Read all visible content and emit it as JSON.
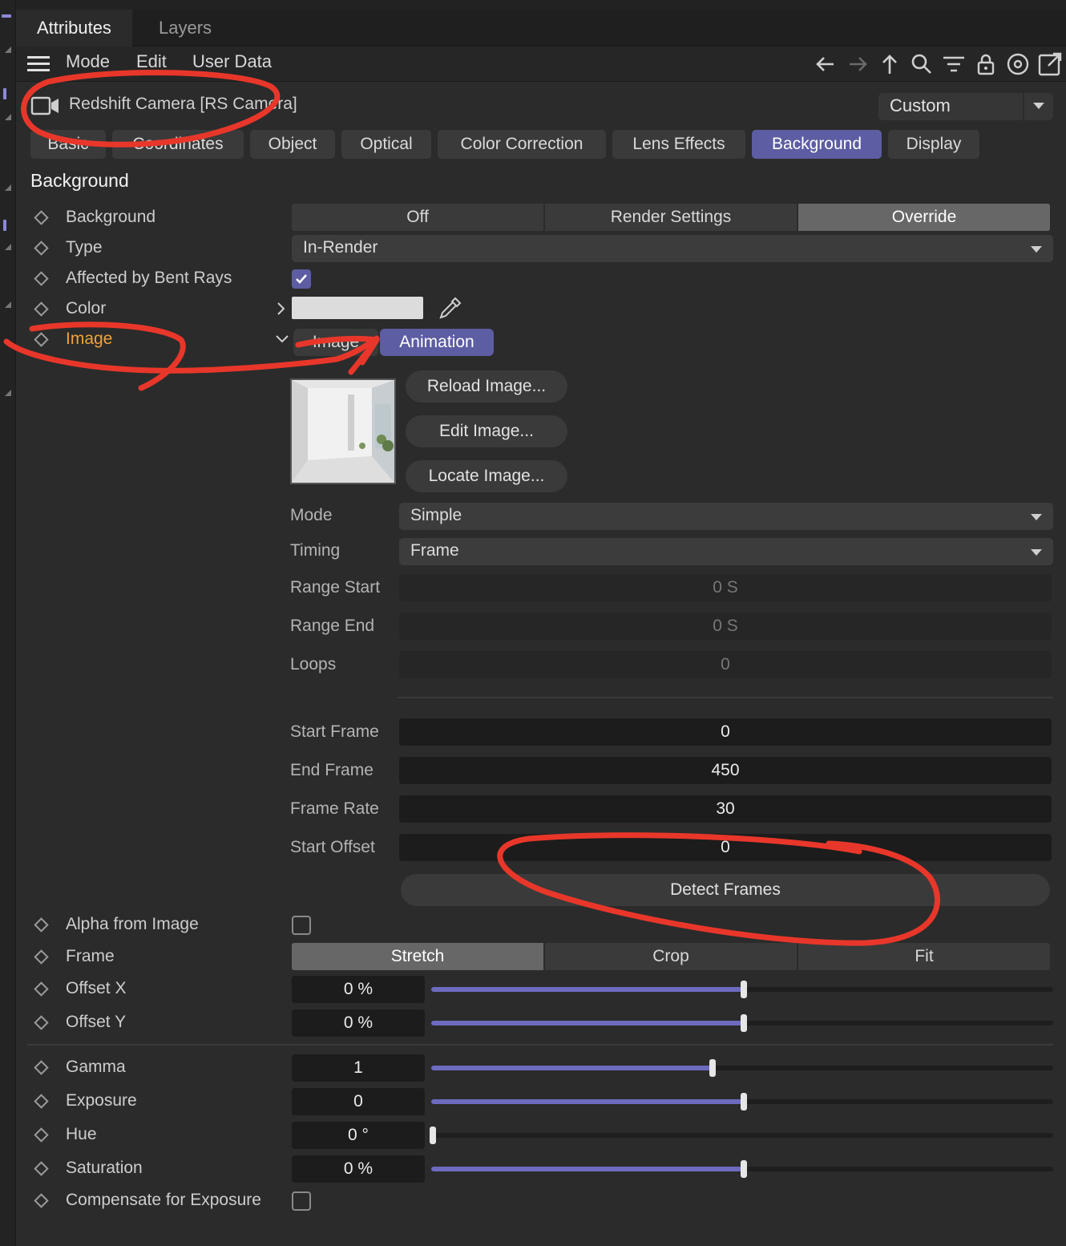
{
  "window_tabs": [
    "Attributes",
    "Layers"
  ],
  "menu": [
    "Mode",
    "Edit",
    "User Data"
  ],
  "toolbar_icons": [
    "arrow-left-icon",
    "arrow-right-icon",
    "arrow-up-icon",
    "search-icon",
    "filter-icon",
    "lock-icon",
    "target-icon",
    "new-window-icon"
  ],
  "object": {
    "title": "Redshift Camera [RS Camera]",
    "preset": "Custom"
  },
  "page_tabs": [
    "Basic",
    "Coordinates",
    "Object",
    "Optical",
    "Color Correction",
    "Lens Effects",
    "Background",
    "Display"
  ],
  "active_tab": "Background",
  "section_title": "Background",
  "rows": {
    "background": {
      "label": "Background",
      "options": [
        "Off",
        "Render Settings",
        "Override"
      ],
      "selected": "Override"
    },
    "type": {
      "label": "Type",
      "value": "In-Render"
    },
    "bent_rays": {
      "label": "Affected by Bent Rays",
      "checked": true
    },
    "color": {
      "label": "Color",
      "swatch": "#dcdcdc"
    },
    "image": {
      "label": "Image",
      "subtabs": [
        "Image",
        "Animation"
      ],
      "active_subtab": "Animation"
    }
  },
  "image_buttons": [
    "Reload Image...",
    "Edit Image...",
    "Locate Image..."
  ],
  "anim": {
    "mode": {
      "label": "Mode",
      "value": "Simple"
    },
    "timing": {
      "label": "Timing",
      "value": "Frame"
    },
    "range_start": {
      "label": "Range Start",
      "value": "0 S"
    },
    "range_end": {
      "label": "Range End",
      "value": "0 S"
    },
    "loops": {
      "label": "Loops",
      "value": "0"
    },
    "start_frame": {
      "label": "Start Frame",
      "value": "0"
    },
    "end_frame": {
      "label": "End Frame",
      "value": "450"
    },
    "frame_rate": {
      "label": "Frame Rate",
      "value": "30"
    },
    "start_offset": {
      "label": "Start Offset",
      "value": "0"
    },
    "detect_button": "Detect Frames"
  },
  "alpha": {
    "label": "Alpha from Image",
    "checked": false
  },
  "frame": {
    "label": "Frame",
    "options": [
      "Stretch",
      "Crop",
      "Fit"
    ],
    "selected": "Stretch"
  },
  "sliders": {
    "offset_x": {
      "label": "Offset X",
      "value": "0 %",
      "level": 0.5
    },
    "offset_y": {
      "label": "Offset Y",
      "value": "0 %",
      "level": 0.5
    },
    "gamma": {
      "label": "Gamma",
      "value": "1",
      "level": 0.45
    },
    "exposure": {
      "label": "Exposure",
      "value": "0",
      "level": 0.5
    },
    "hue": {
      "label": "Hue",
      "value": "0 °",
      "level": 0.0
    },
    "saturation": {
      "label": "Saturation",
      "value": "0 %",
      "level": 0.5
    }
  },
  "compensate": {
    "label": "Compensate for Exposure",
    "checked": false
  },
  "colors": {
    "accent": "#5d5da3",
    "annotation": "#e8372a",
    "highlight_label": "#f1a23c"
  }
}
